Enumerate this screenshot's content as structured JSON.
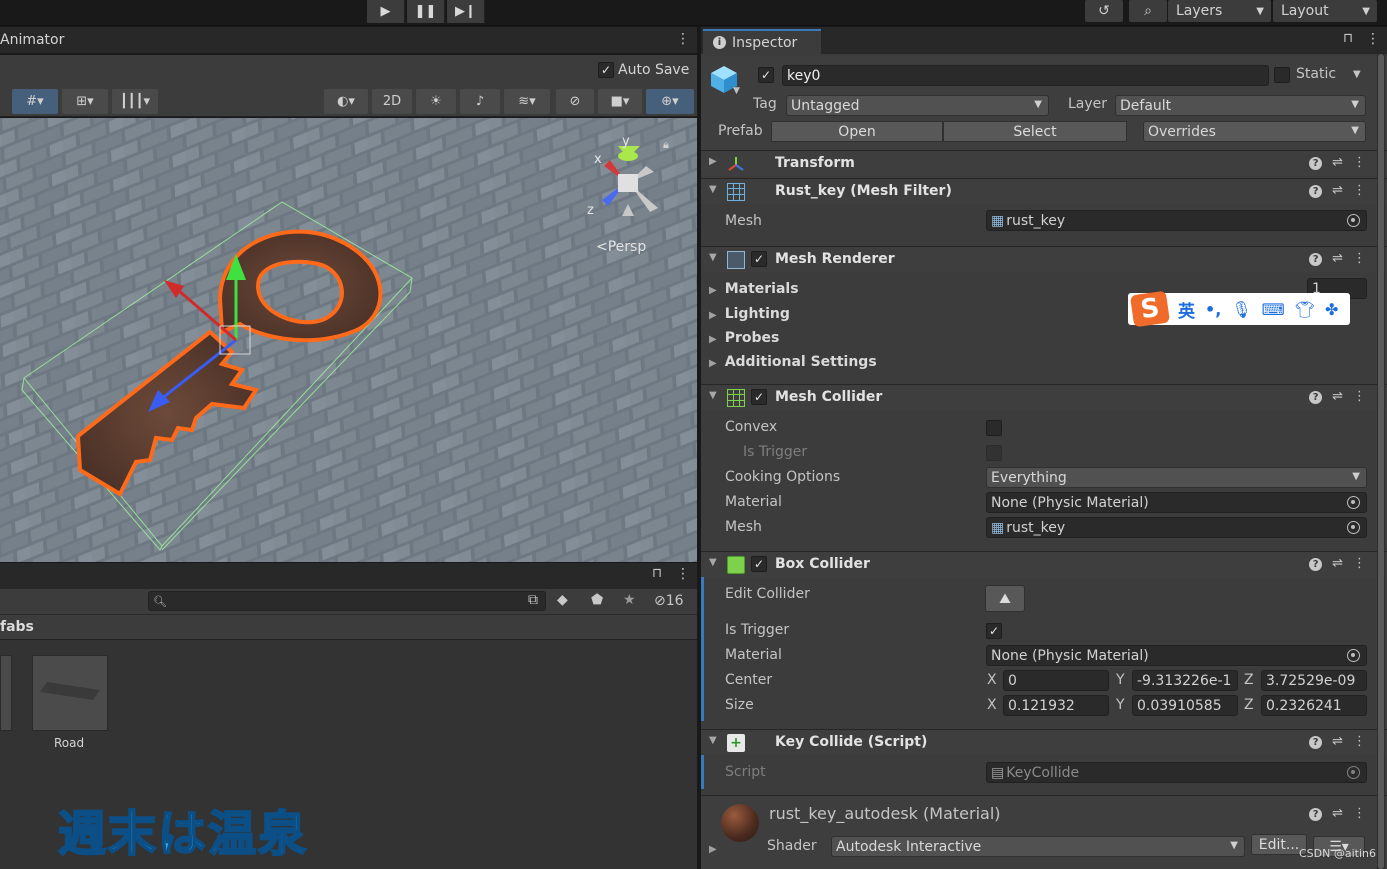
{
  "toolbar": {
    "play_icon": "play-icon",
    "layers_label": "Layers",
    "layout_label": "Layout"
  },
  "animator": {
    "tab_label": "Animator",
    "auto_save_label": "Auto Save",
    "auto_save_checked": true
  },
  "scene": {
    "toolbar_2d_label": "2D",
    "gizmo_persp_label": "<Persp",
    "axis_y": "y",
    "axis_x": "x",
    "axis_z": "z"
  },
  "project": {
    "search_placeholder": "",
    "hidden_count": "16",
    "breadcrumb_label": "fabs",
    "assets": [
      {
        "name": "Road"
      }
    ],
    "overlay_text": "週末は温泉"
  },
  "inspector": {
    "tab_label": "Inspector",
    "object_active": true,
    "object_name": "key0",
    "static_label": "Static",
    "tag_label": "Tag",
    "tag_value": "Untagged",
    "layer_label": "Layer",
    "layer_value": "Default",
    "prefab_label": "Prefab",
    "prefab_open": "Open",
    "prefab_select": "Select",
    "prefab_overrides": "Overrides",
    "components": {
      "transform": {
        "title": "Transform"
      },
      "mesh_filter": {
        "title": "Rust_key (Mesh Filter)",
        "mesh_label": "Mesh",
        "mesh_value": "rust_key"
      },
      "mesh_renderer": {
        "title": "Mesh Renderer",
        "enabled": true,
        "sections": [
          "Materials",
          "Lighting",
          "Probes",
          "Additional Settings"
        ],
        "materials_count": "1"
      },
      "mesh_collider": {
        "title": "Mesh Collider",
        "enabled": true,
        "convex_label": "Convex",
        "is_trigger_label": "Is Trigger",
        "cooking_label": "Cooking Options",
        "cooking_value": "Everything",
        "material_label": "Material",
        "material_value": "None (Physic Material)",
        "mesh_label": "Mesh",
        "mesh_value": "rust_key"
      },
      "box_collider": {
        "title": "Box Collider",
        "enabled": true,
        "edit_label": "Edit Collider",
        "is_trigger_label": "Is Trigger",
        "is_trigger_checked": true,
        "material_label": "Material",
        "material_value": "None (Physic Material)",
        "center_label": "Center",
        "center": {
          "x": "0",
          "y": "-9.313226e-1",
          "z": "3.72529e-09"
        },
        "size_label": "Size",
        "size": {
          "x": "0.121932",
          "y": "0.03910585",
          "z": "0.2326241"
        },
        "x_label": "X",
        "y_label": "Y",
        "z_label": "Z"
      },
      "key_collide": {
        "title": "Key Collide (Script)",
        "script_label": "Script",
        "script_value": "KeyCollide"
      },
      "material": {
        "title": "rust_key_autodesk (Material)",
        "shader_label": "Shader",
        "shader_value": "Autodesk Interactive",
        "edit_label": "Edit..."
      }
    }
  },
  "ime": {
    "logo": "S",
    "lang": "英",
    "punct": "•,"
  },
  "watermark": "CSDN @aitin6"
}
